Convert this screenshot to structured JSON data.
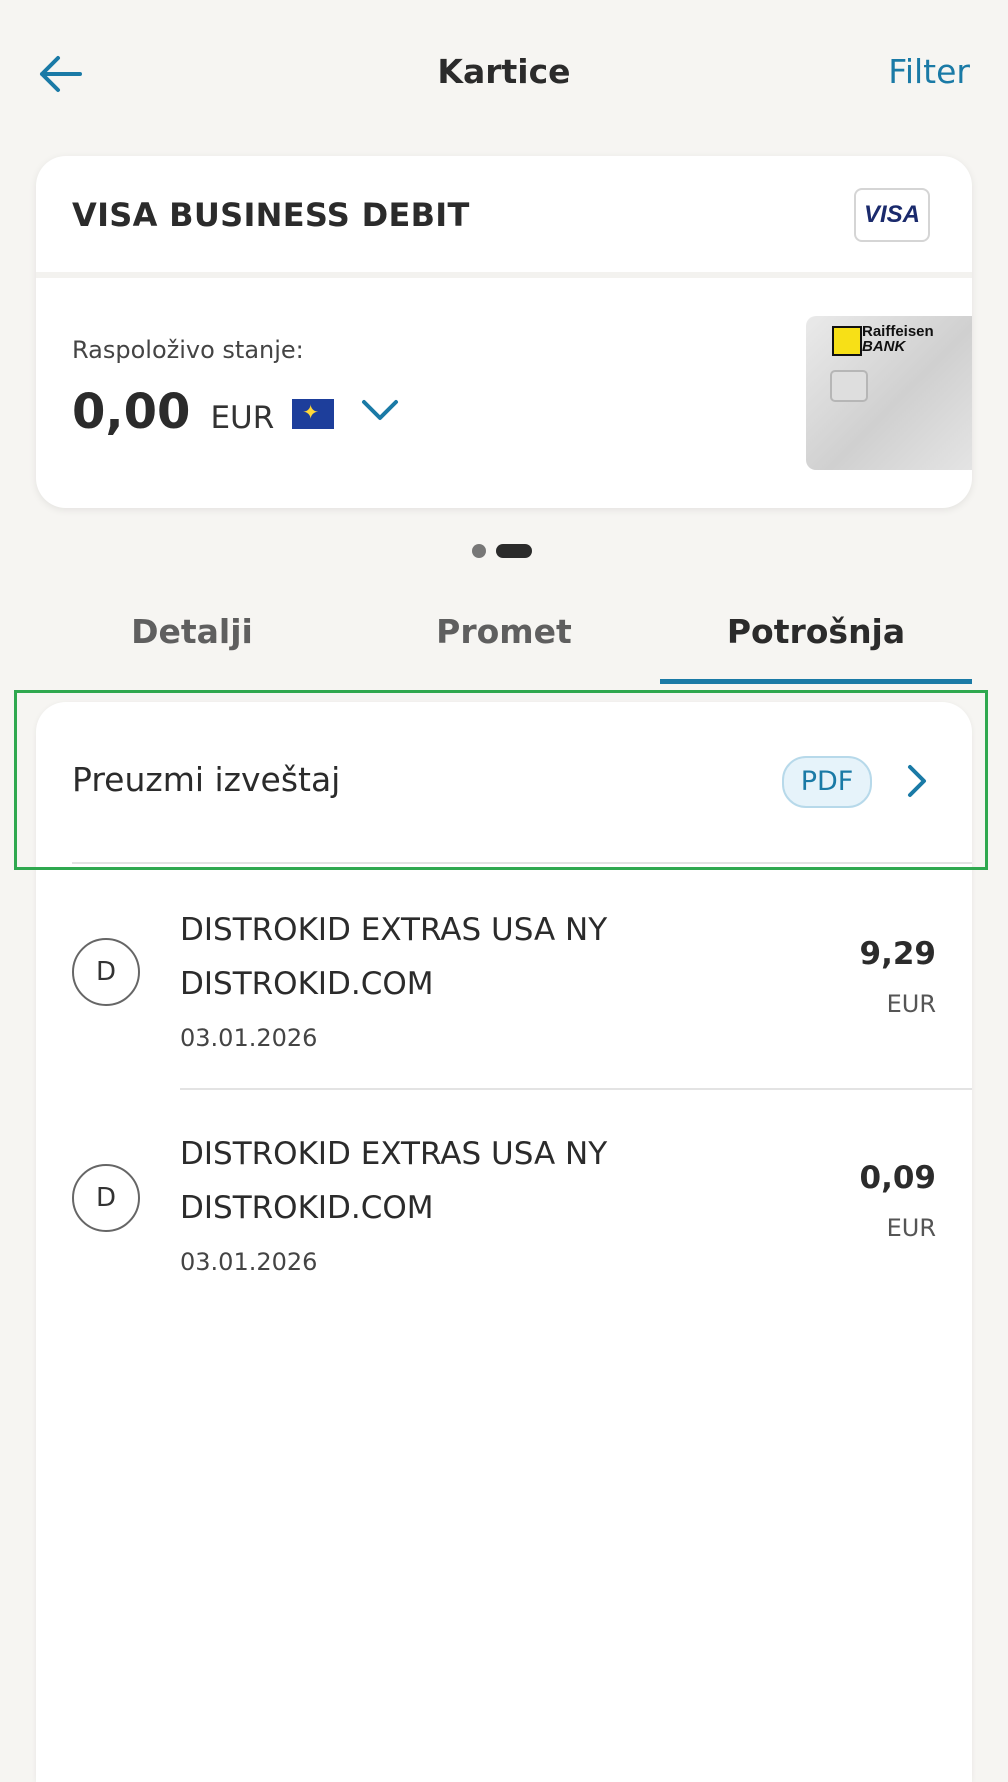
{
  "header": {
    "title": "Kartice",
    "filter_label": "Filter"
  },
  "card": {
    "name": "VISA BUSINESS DEBIT",
    "network_badge": "VISA",
    "available_label": "Raspoloživo stanje:",
    "amount": "0,00",
    "currency": "EUR",
    "flag_icon": "eu-flag-icon",
    "card_logo_text_1": "Raiffeisen",
    "card_logo_text_2": "BANK"
  },
  "pager": {
    "count": 2,
    "active_index": 1
  },
  "tabs": [
    {
      "label": "Detalji",
      "active": false
    },
    {
      "label": "Promet",
      "active": false
    },
    {
      "label": "Potrošnja",
      "active": true
    }
  ],
  "report": {
    "label": "Preuzmi izveštaj",
    "badge": "PDF"
  },
  "transactions": [
    {
      "avatar": "D",
      "line1": "DISTROKID EXTRAS USA NY",
      "line2": "DISTROKID.COM",
      "date": "03.01.2026",
      "amount": "9,29",
      "currency": "EUR"
    },
    {
      "avatar": "D",
      "line1": "DISTROKID EXTRAS USA NY",
      "line2": "DISTROKID.COM",
      "date": "03.01.2026",
      "amount": "0,09",
      "currency": "EUR"
    }
  ],
  "colors": {
    "accent": "#1a7aa6",
    "background": "#f6f5f2",
    "highlight": "#2fa84f"
  }
}
